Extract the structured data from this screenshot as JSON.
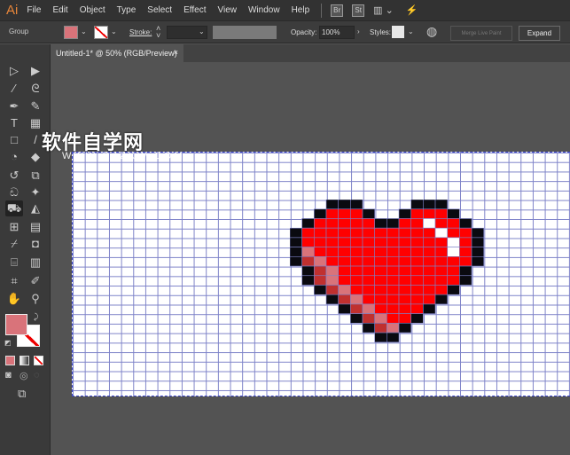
{
  "app": {
    "logo": "Ai"
  },
  "menu": [
    "File",
    "Edit",
    "Object",
    "Type",
    "Select",
    "Effect",
    "View",
    "Window",
    "Help"
  ],
  "menu_icons": {
    "bridge": "Br",
    "stock": "St"
  },
  "control": {
    "selection": "Group",
    "stroke_label": "Stroke:",
    "opacity_label": "Opacity:",
    "opacity_value": "100%",
    "styles_label": "Styles:",
    "merge_button": "Merge Live Paint",
    "expand_button": "Expand",
    "fill_color": "#d9737a"
  },
  "document_tab": {
    "title": "Untitled-1* @ 50% (RGB/Preview)",
    "close": "×"
  },
  "watermark": {
    "text": "软件自学网",
    "url": "WWW.RJZXW.COM"
  },
  "colors": {
    "red": "#ff0000",
    "black": "#0a0a10",
    "white": "#ffffff",
    "pink": "#d9737a",
    "dark": "#c0302f"
  },
  "artwork": {
    "pixel_rows": [
      "...KKK....KKK...",
      "..KRRRK..KRRRK..",
      ".KRRRRRKKRRWRRK.",
      "KRRRRRRRRRRRWRRK",
      "KRRRRRRRRRRRRWRK",
      "KPRRRRRRRRRRRWRK",
      "KDPRRRRRRRRRRRRK",
      ".KDPRRRRRRRRRRK.",
      ".KDPRRRRRRRRRRK.",
      "..KDPRRRRRRRRK..",
      "...KDPRRRRRRK...",
      "....KDPRRRRK....",
      ".....KDPRRK.....",
      "......KDPK......",
      ".......KK......."
    ]
  }
}
